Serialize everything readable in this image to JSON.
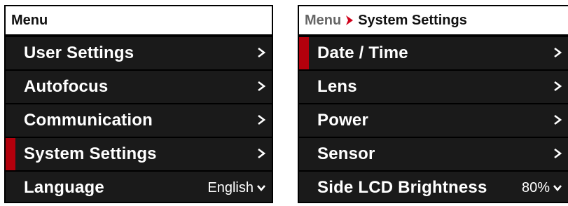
{
  "left": {
    "header": "Menu",
    "items": [
      {
        "label": "User Settings"
      },
      {
        "label": "Autofocus"
      },
      {
        "label": "Communication"
      },
      {
        "label": "System Settings"
      },
      {
        "label": "Language",
        "value": "English"
      }
    ]
  },
  "right": {
    "breadcrumb_root": "Menu",
    "breadcrumb_current": "System Settings",
    "items": [
      {
        "label": "Date / Time"
      },
      {
        "label": "Lens"
      },
      {
        "label": "Power"
      },
      {
        "label": "Sensor"
      },
      {
        "label": "Side LCD Brightness",
        "value": "80%"
      }
    ]
  },
  "colors": {
    "selection_indicator": "#b3000c",
    "breadcrumb_arrow": "#d0021b",
    "row_background": "#1a1a1a"
  }
}
